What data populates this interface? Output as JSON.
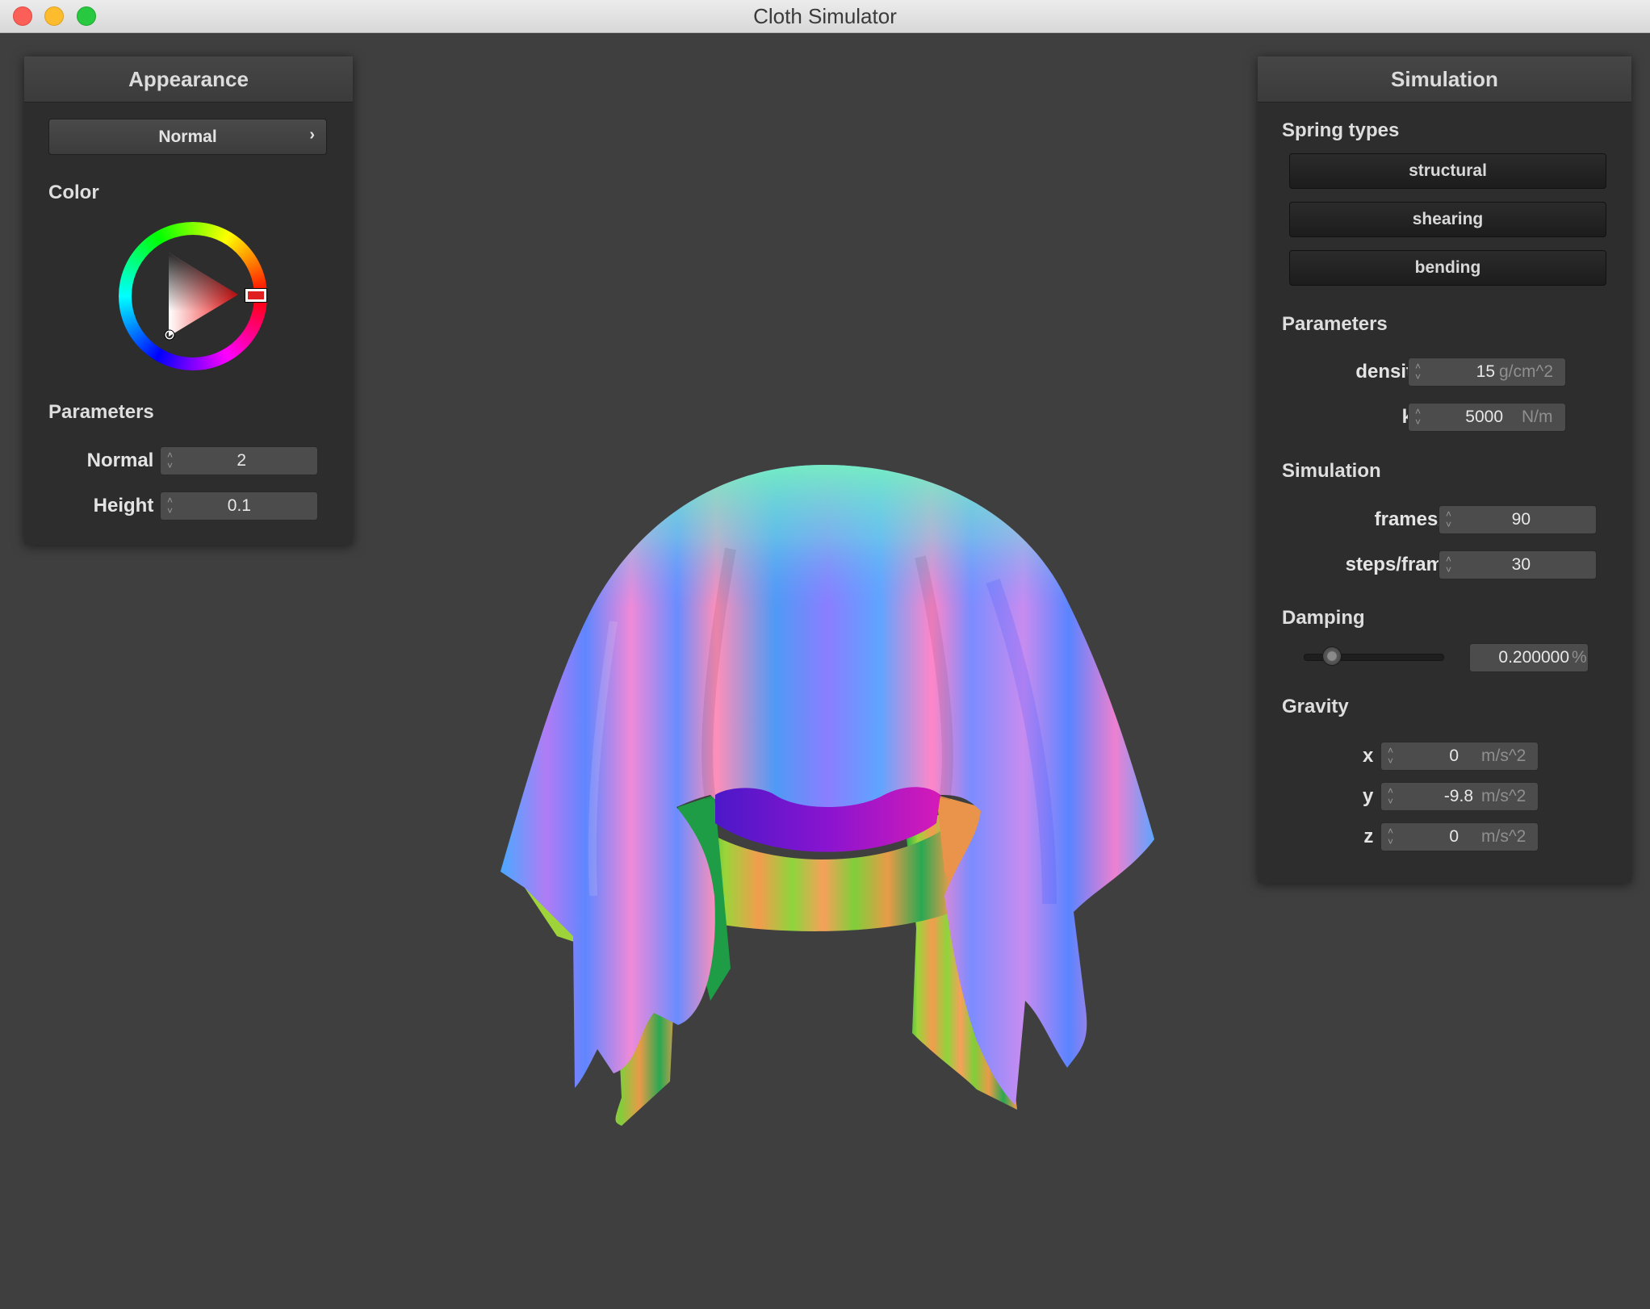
{
  "window": {
    "title": "Cloth Simulator"
  },
  "appearance": {
    "title": "Appearance",
    "shader": "Normal",
    "chevron": "›",
    "color_label": "Color",
    "params_label": "Parameters",
    "normal_label": "Normal :",
    "normal_value": "2",
    "height_label": "Height :",
    "height_value": "0.1"
  },
  "simulation": {
    "title": "Simulation",
    "spring_label": "Spring types",
    "springs": [
      "structural",
      "shearing",
      "bending"
    ],
    "params_label": "Parameters",
    "density_label": "density :",
    "density_value": "15",
    "density_unit": "g/cm^2",
    "ks_label": "ks :",
    "ks_value": "5000",
    "ks_unit": "N/m",
    "sim_label": "Simulation",
    "fps_label": "frames/s :",
    "fps_value": "90",
    "steps_label": "steps/frame :",
    "steps_value": "30",
    "damping_label": "Damping",
    "damping_value": "0.200000",
    "damping_unit": "%",
    "damping_slider_fraction": 0.2,
    "gravity_label": "Gravity",
    "gx_label": "x :",
    "gx_value": "0",
    "gy_label": "y :",
    "gy_value": "-9.8",
    "gz_label": "z :",
    "gz_value": "0",
    "g_unit": "m/s^2"
  },
  "colors": {
    "background": "#3f3f3f",
    "panel": "#2d2d2d",
    "selected_color": "#e02020"
  },
  "icons": [
    "close-icon",
    "minimize-icon",
    "maximize-icon",
    "chevron-right-icon",
    "spin-arrows-icon"
  ]
}
